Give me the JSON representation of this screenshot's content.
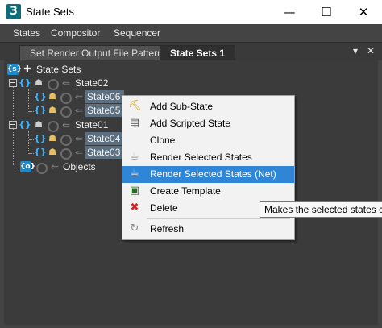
{
  "window": {
    "title": "State Sets",
    "app_icon_glyph": "3",
    "controls": {
      "minimize": "—",
      "maximize": "☐",
      "close": "✕"
    }
  },
  "menu": [
    "States",
    "Compositor",
    "Sequencer"
  ],
  "tabs": {
    "inactive_label": "Set Render Output File Pattern",
    "active_label": "State Sets 1",
    "dropdown_glyph": "▾",
    "close_glyph": "✕"
  },
  "tree": {
    "root_label": "State Sets",
    "nodes": {
      "state02": "State02",
      "state06": "State06",
      "state05": "State05",
      "state01": "State01",
      "state04": "State04",
      "state03": "State03",
      "objects": "Objects"
    }
  },
  "context_menu": {
    "items": [
      {
        "label": "Add Sub-State",
        "icon": "add-substate-icon"
      },
      {
        "label": "Add Scripted State",
        "icon": "script-icon"
      },
      {
        "label": "Clone",
        "icon": ""
      },
      {
        "label": "Render Selected States",
        "icon": "teapot-icon"
      },
      {
        "label": "Render Selected States (Net)",
        "icon": "teapot-net-icon"
      },
      {
        "label": "Create Template",
        "icon": "template-icon"
      },
      {
        "label": "Delete",
        "icon": "delete-x-icon"
      },
      {
        "label": "Refresh",
        "icon": "refresh-icon"
      }
    ],
    "highlighted_index": 4
  },
  "tooltip": {
    "text": "Makes the selected states cur"
  },
  "colors": {
    "window_bg": "#444444",
    "tree_bg": "#3b3b3b",
    "selection": "#5b6f80",
    "menu_highlight": "#2f86d6",
    "brace_blue": "#39b6ff",
    "delete_red": "#e02020"
  }
}
